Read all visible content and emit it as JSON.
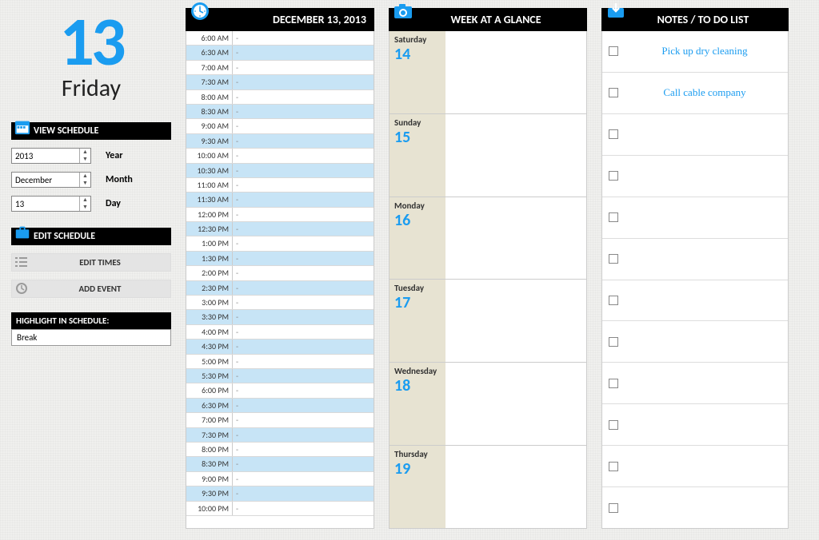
{
  "header": {
    "big_number": "13",
    "big_day": "Friday"
  },
  "view_schedule": {
    "title": "VIEW SCHEDULE",
    "year": {
      "value": "2013",
      "label": "Year"
    },
    "month": {
      "value": "December",
      "label": "Month"
    },
    "day": {
      "value": "13",
      "label": "Day"
    }
  },
  "edit_schedule": {
    "title": "EDIT SCHEDULE",
    "edit_times": "EDIT TIMES",
    "add_event": "ADD EVENT"
  },
  "highlight": {
    "title": "HIGHLIGHT IN SCHEDULE:",
    "value": "Break"
  },
  "schedule": {
    "title": "DECEMBER 13, 2013",
    "slots": [
      {
        "t": "6:00 AM",
        "v": "-"
      },
      {
        "t": "6:30 AM",
        "v": "-"
      },
      {
        "t": "7:00 AM",
        "v": "-"
      },
      {
        "t": "7:30 AM",
        "v": "-"
      },
      {
        "t": "8:00 AM",
        "v": "-"
      },
      {
        "t": "8:30 AM",
        "v": "-"
      },
      {
        "t": "9:00 AM",
        "v": "-"
      },
      {
        "t": "9:30 AM",
        "v": "-"
      },
      {
        "t": "10:00 AM",
        "v": "-"
      },
      {
        "t": "10:30 AM",
        "v": "-"
      },
      {
        "t": "11:00 AM",
        "v": "-"
      },
      {
        "t": "11:30 AM",
        "v": "-"
      },
      {
        "t": "12:00 PM",
        "v": "-"
      },
      {
        "t": "12:30 PM",
        "v": "-"
      },
      {
        "t": "1:00 PM",
        "v": "-"
      },
      {
        "t": "1:30 PM",
        "v": "-"
      },
      {
        "t": "2:00 PM",
        "v": "-"
      },
      {
        "t": "2:30 PM",
        "v": "-"
      },
      {
        "t": "3:00 PM",
        "v": "-"
      },
      {
        "t": "3:30 PM",
        "v": "-"
      },
      {
        "t": "4:00 PM",
        "v": "-"
      },
      {
        "t": "4:30 PM",
        "v": "-"
      },
      {
        "t": "5:00 PM",
        "v": "-"
      },
      {
        "t": "5:30 PM",
        "v": "-"
      },
      {
        "t": "6:00 PM",
        "v": "-"
      },
      {
        "t": "6:30 PM",
        "v": "-"
      },
      {
        "t": "7:00 PM",
        "v": "-"
      },
      {
        "t": "7:30 PM",
        "v": "-"
      },
      {
        "t": "8:00 PM",
        "v": "-"
      },
      {
        "t": "8:30 PM",
        "v": "-"
      },
      {
        "t": "9:00 PM",
        "v": "-"
      },
      {
        "t": "9:30 PM",
        "v": "-"
      },
      {
        "t": "10:00 PM",
        "v": "-"
      }
    ]
  },
  "week": {
    "title": "WEEK AT A GLANCE",
    "days": [
      {
        "name": "Saturday",
        "num": "14"
      },
      {
        "name": "Sunday",
        "num": "15"
      },
      {
        "name": "Monday",
        "num": "16"
      },
      {
        "name": "Tuesday",
        "num": "17"
      },
      {
        "name": "Wednesday",
        "num": "18"
      },
      {
        "name": "Thursday",
        "num": "19"
      }
    ]
  },
  "notes": {
    "title": "NOTES / TO DO LIST",
    "items": [
      {
        "text": "Pick up dry cleaning",
        "checked": false
      },
      {
        "text": "Call cable company",
        "checked": false
      },
      {
        "text": "",
        "checked": false
      },
      {
        "text": "",
        "checked": false
      },
      {
        "text": "",
        "checked": false
      },
      {
        "text": "",
        "checked": false
      },
      {
        "text": "",
        "checked": false
      },
      {
        "text": "",
        "checked": false
      },
      {
        "text": "",
        "checked": false
      },
      {
        "text": "",
        "checked": false
      },
      {
        "text": "",
        "checked": false
      },
      {
        "text": "",
        "checked": false
      }
    ]
  }
}
